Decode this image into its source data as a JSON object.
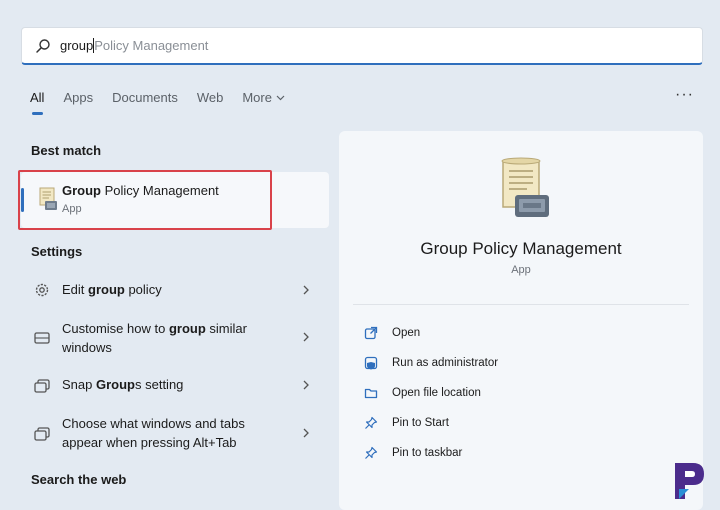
{
  "search": {
    "typed": "group",
    "suggestion": "Policy Management"
  },
  "tabs": [
    {
      "label": "All",
      "active": true
    },
    {
      "label": "Apps"
    },
    {
      "label": "Documents"
    },
    {
      "label": "Web"
    },
    {
      "label": "More"
    }
  ],
  "more_options_label": "···",
  "best_match": {
    "heading": "Best match",
    "item": {
      "title_bold": "Group",
      "title_rest": " Policy Management",
      "subtitle": "App",
      "icon": "policy-scroll-icon"
    }
  },
  "settings": {
    "heading": "Settings",
    "items": [
      {
        "pre": "Edit ",
        "bold": "group",
        "post": " policy",
        "icon": "gear-icon"
      },
      {
        "pre": "Customise how to ",
        "bold": "group",
        "post": " similar windows",
        "icon": "window-icon"
      },
      {
        "pre": "Snap ",
        "bold": "Group",
        "post": "s setting",
        "icon": "snap-icon"
      },
      {
        "pre": "Choose what windows and tabs appear when pressing Alt+Tab",
        "bold": "",
        "post": "",
        "icon": "switch-window-icon"
      }
    ]
  },
  "search_web_heading": "Search the web",
  "details": {
    "title": "Group Policy Management",
    "subtitle": "App",
    "actions": [
      {
        "label": "Open",
        "icon": "open-external-icon"
      },
      {
        "label": "Run as administrator",
        "icon": "shield-icon"
      },
      {
        "label": "Open file location",
        "icon": "folder-icon"
      },
      {
        "label": "Pin to Start",
        "icon": "pin-icon"
      },
      {
        "label": "Pin to taskbar",
        "icon": "pin-icon"
      }
    ]
  },
  "colors": {
    "accent": "#2f6fbd",
    "highlight_box": "#d9424a",
    "brand_logo": "#4b2c8c"
  }
}
